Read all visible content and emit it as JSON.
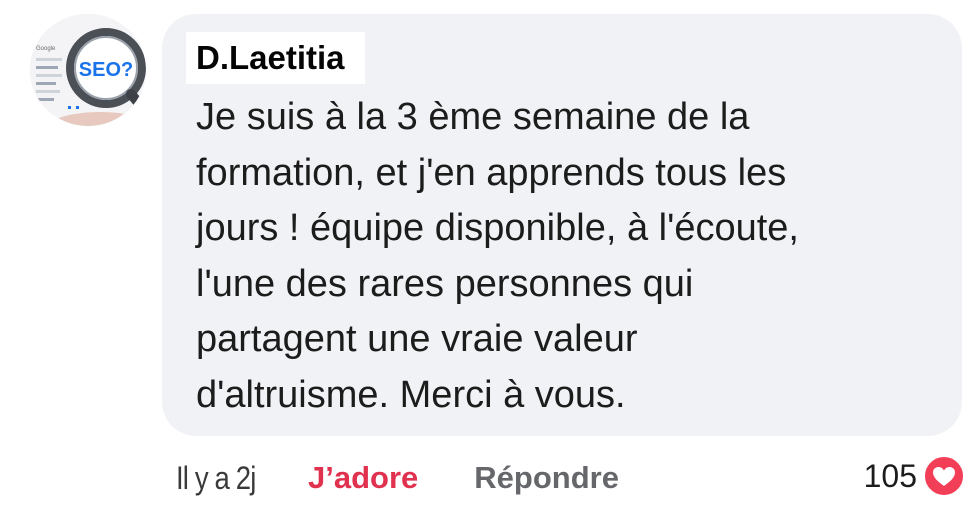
{
  "comment": {
    "author": "D.Laetitia",
    "text": "Je suis à la 3 ème semaine de la\nformation, et j'en apprends tous les\njours ! équipe disponible, à l'écoute,\nl'une des rares personnes qui\npartagent une vraie valeur\nd'altruisme. Merci à vous.",
    "avatar_label": "SEO?",
    "avatar_small_text": "Google"
  },
  "actions": {
    "timestamp": "Il y a 2j",
    "love_label": "J’adore",
    "reply_label": "Répondre"
  },
  "reactions": {
    "count": "105",
    "icon": "heart-icon"
  },
  "colors": {
    "bubble": "#f0f2f5",
    "love": "#e0314f",
    "reply": "#65676b",
    "heart": "#f33e58",
    "seo_blue": "#1a73e8"
  }
}
